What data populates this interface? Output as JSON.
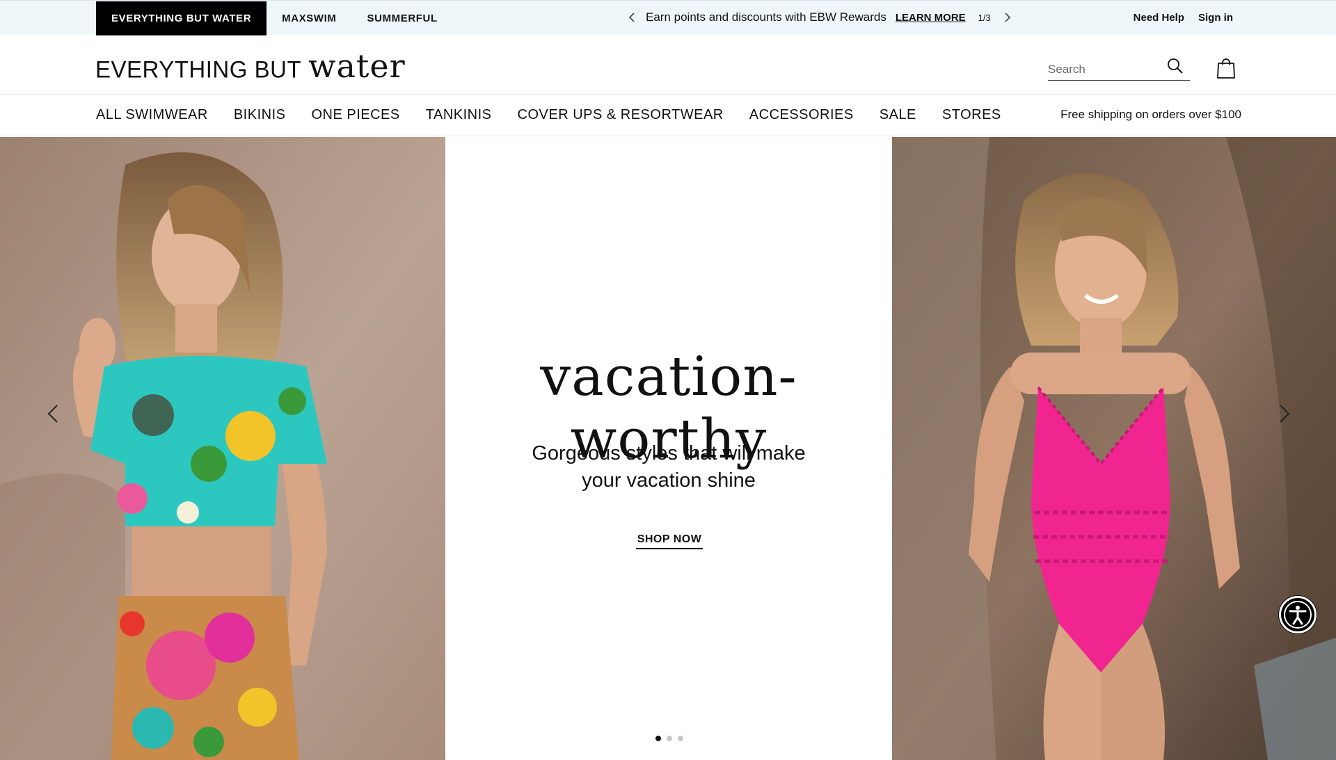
{
  "brand_tabs": [
    {
      "label": "EVERYTHING BUT WATER",
      "active": true
    },
    {
      "label": "MAXSWIM",
      "active": false
    },
    {
      "label": "SUMMERFUL",
      "active": false
    }
  ],
  "promo": {
    "text": "Earn points and discounts with EBW Rewards",
    "link": "LEARN MORE",
    "counter": "1/3",
    "prev_icon": "chevron-left-icon",
    "next_icon": "chevron-right-icon"
  },
  "account": {
    "help": "Need Help",
    "sign_in": "Sign in"
  },
  "logo": {
    "part1": "EVERYTHING BUT",
    "part2": "water"
  },
  "search": {
    "placeholder": "Search",
    "value": "",
    "icon": "search-icon"
  },
  "cart": {
    "icon": "shopping-bag-icon"
  },
  "nav": {
    "items": [
      "ALL SWIMWEAR",
      "BIKINIS",
      "ONE PIECES",
      "TANKINIS",
      "COVER UPS & RESORTWEAR",
      "ACCESSORIES",
      "SALE",
      "STORES"
    ],
    "shipping_note": "Free shipping on orders over $100"
  },
  "hero": {
    "heading": "vacation-worthy",
    "subtitle_line1": "Gorgeous styles that will make",
    "subtitle_line2": "your vacation shine",
    "cta": "SHOP NOW",
    "slide_count": 3,
    "active_slide": 1,
    "left_image": "model in tropical floral crop top and skirt",
    "right_image": "model in pink one-piece swimsuit",
    "prev_icon": "chevron-left-icon",
    "next_icon": "chevron-right-icon"
  },
  "accessibility": {
    "icon": "accessibility-icon"
  },
  "colors": {
    "utility_bar_bg": "#eef6f9",
    "active_tab_bg": "#000000",
    "swimsuit_pink": "#f0258f",
    "background": "#ffffff"
  }
}
